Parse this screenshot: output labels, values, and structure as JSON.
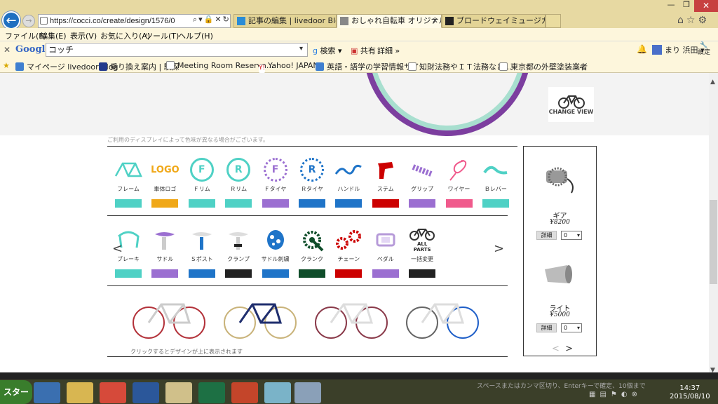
{
  "browser": {
    "url": "https://cocci.co/create/design/1576/0",
    "tabs": [
      {
        "label": "記事の編集 | livedoor Blog",
        "active": false
      },
      {
        "label": "おしゃれ自転車 オリジナル自…",
        "active": true
      },
      {
        "label": "ブロードウェイミュージカル ピピン | …",
        "active": false
      }
    ],
    "menu": [
      "ファイル(F)",
      "編集(E)",
      "表示(V)",
      "お気に入り(A)",
      "ツール(T)",
      "ヘルプ(H)"
    ],
    "google": {
      "logo": "Google",
      "query": "コッチ",
      "search": "検索",
      "share": "共有",
      "more": "詳細",
      "user": "まり 浜田",
      "settings": "設定"
    },
    "favorites": [
      "マイページ livedoor Blog",
      "乗り換え案内 | 駅探",
      "Meeting Room Reserva...",
      "Yahoo! JAPAN",
      "英語・語学の学習情報サイ...",
      "知財法務やＩＴ法務など...",
      "東京都の外壁塗装業者",
      "…"
    ]
  },
  "page": {
    "change_view": "CHANGE VIEW",
    "display_note": "ご利用のディスプレイによって色味が異なる場合がございます。",
    "parts_row1": [
      {
        "label": "フレーム",
        "icon": "frame-icon",
        "swatch": "#4fd1c5"
      },
      {
        "label": "車体ロゴ",
        "icon": "logo-text",
        "text": "LOGO",
        "swatch": "#f0a818"
      },
      {
        "label": "Ｆリム",
        "icon": "f-rim-icon",
        "text": "F",
        "swatch": "#4fd1c5"
      },
      {
        "label": "Ｒリム",
        "icon": "r-rim-icon",
        "text": "R",
        "swatch": "#4fd1c5"
      },
      {
        "label": "Ｆタイヤ",
        "icon": "f-tire-icon",
        "text": "F",
        "swatch": "#9b6fd1"
      },
      {
        "label": "Ｒタイヤ",
        "icon": "r-tire-icon",
        "text": "R",
        "swatch": "#1f74c8"
      },
      {
        "label": "ハンドル",
        "icon": "handlebar-icon",
        "swatch": "#1f74c8"
      },
      {
        "label": "ステム",
        "icon": "stem-icon",
        "swatch": "#cc0000"
      },
      {
        "label": "グリップ",
        "icon": "grip-icon",
        "swatch": "#9b6fd1"
      },
      {
        "label": "ワイヤー",
        "icon": "wire-icon",
        "swatch": "#f05a8c"
      },
      {
        "label": "Ｂレバー",
        "icon": "brake-lever-icon",
        "swatch": "#4fd1c5"
      }
    ],
    "parts_row2": [
      {
        "label": "ブレーキ",
        "icon": "brake-icon",
        "swatch": "#4fd1c5"
      },
      {
        "label": "サドル",
        "icon": "saddle-icon",
        "swatch": "#9b6fd1"
      },
      {
        "label": "Ｓポスト",
        "icon": "seatpost-icon",
        "swatch": "#1f74c8"
      },
      {
        "label": "クランプ",
        "icon": "clamp-icon",
        "swatch": "#222222"
      },
      {
        "label": "サドル刺繍",
        "icon": "saddle-embroidery-icon",
        "swatch": "#1f74c8"
      },
      {
        "label": "クランク",
        "icon": "crank-icon",
        "swatch": "#0f4d2a"
      },
      {
        "label": "チェーン",
        "icon": "chain-icon",
        "swatch": "#cc0000"
      },
      {
        "label": "ペダル",
        "icon": "pedal-icon",
        "swatch": "#9b6fd1"
      },
      {
        "label": "一括変更",
        "icon": "all-parts-icon",
        "text": "ALL PARTS",
        "swatch": "#222222"
      }
    ],
    "bike_carousel_note": "クリックするとデザインが上に表示されます",
    "prev": "<",
    "next": ">",
    "accessories": [
      {
        "name": "ギア",
        "price": "¥8200",
        "detail": "詳細",
        "qty": "0"
      },
      {
        "name": "ライト",
        "price": "¥5000",
        "detail": "詳細",
        "qty": "0"
      }
    ],
    "panel_prev": "<",
    "panel_next": ">"
  },
  "taskbar": {
    "start": "スタート",
    "tray_hint": "スペースまたはカンマ区切り、Enterキーで確定、10個まで",
    "time": "14:37",
    "date": "2015/08/10"
  }
}
